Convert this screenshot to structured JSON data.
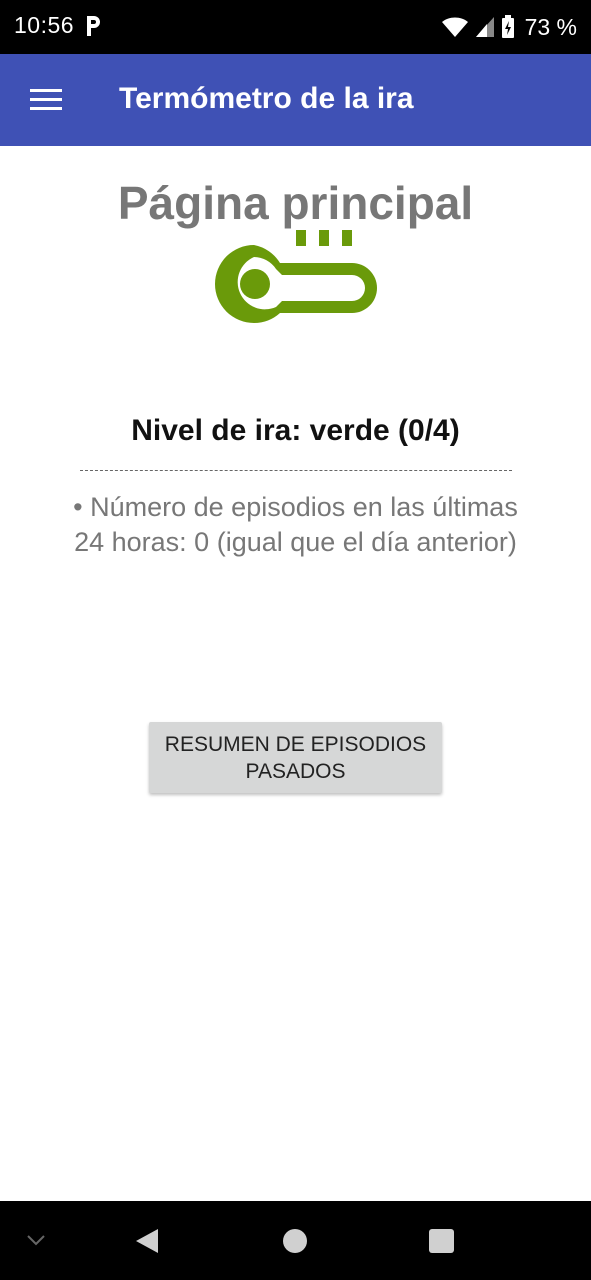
{
  "status_bar": {
    "time": "10:56",
    "battery_percent": "73 %",
    "icons": [
      "parking-p-icon",
      "wifi-icon",
      "signal-icon",
      "battery-icon"
    ]
  },
  "app_bar": {
    "title": "Termómetro de la ira",
    "menu_icon": "hamburger-menu-icon",
    "background": "#3f51b5"
  },
  "main": {
    "heading": "Página principal",
    "thermometer_icon": "thermometer-icon",
    "thermometer_color": "#6a9a0a",
    "level_text": "Nivel de ira: verde (0/4)",
    "divider_text": "-------------------------------------------------------------------",
    "episodes_text": "• Número de episodios en las últimas 24 horas: 0 (igual que el día anterior)",
    "summary_button": "RESUMEN DE EPISODIOS PASADOS"
  },
  "nav_bar": {
    "icons": [
      "chevron-down-icon",
      "back-icon",
      "home-icon",
      "recents-icon"
    ]
  }
}
